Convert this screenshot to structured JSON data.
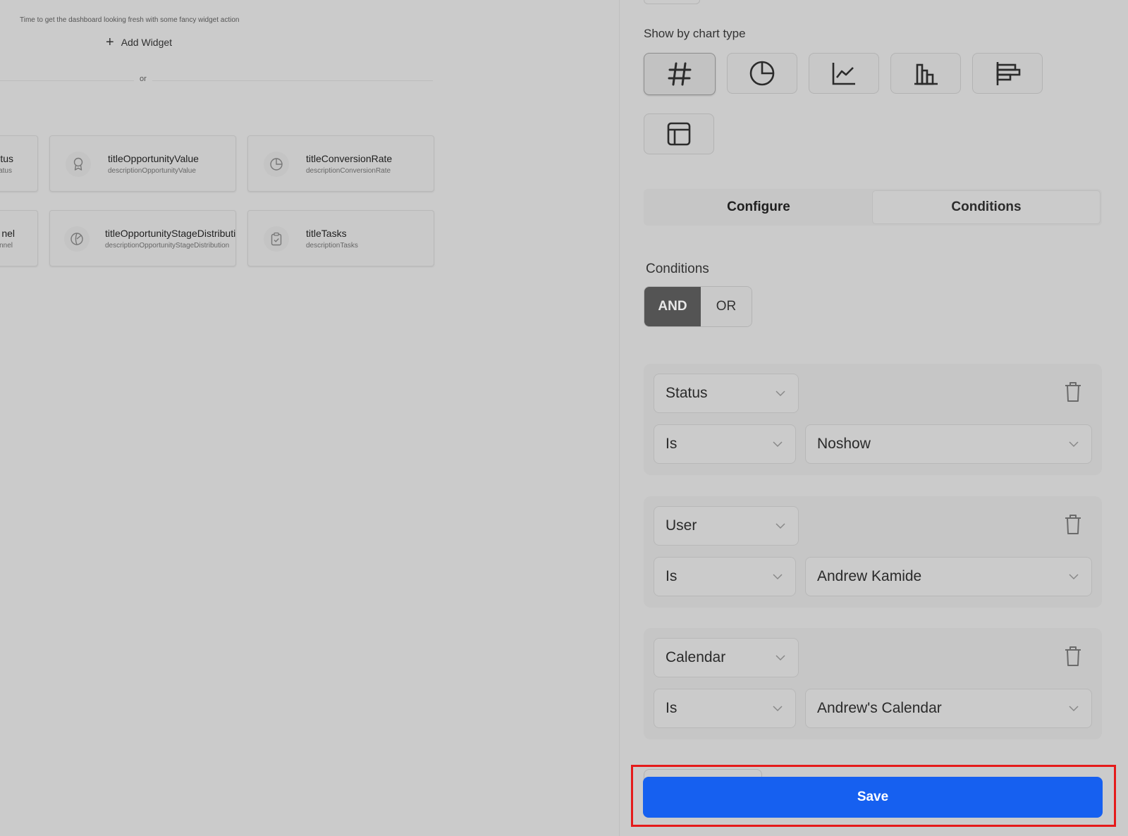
{
  "dashboard": {
    "tagline": "Time to get the dashboard looking fresh with some fancy widget action",
    "add_widget_label": "Add Widget",
    "divider_text": "or",
    "widgets": [
      {
        "title": "tus",
        "description": "atus",
        "icon": "status-icon"
      },
      {
        "title": "titleOpportunityValue",
        "description": "descriptionOpportunityValue",
        "icon": "award-icon"
      },
      {
        "title": "titleConversionRate",
        "description": "descriptionConversionRate",
        "icon": "pie-chart-icon"
      },
      {
        "title": "nel",
        "description": "nnel",
        "icon": "funnel-icon"
      },
      {
        "title": "titleOpportunityStageDistributi",
        "description": "descriptionOpportunityStageDistribution",
        "icon": "stage-distribution-icon"
      },
      {
        "title": "titleTasks",
        "description": "descriptionTasks",
        "icon": "clipboard-check-icon"
      }
    ]
  },
  "panel": {
    "chart_type_label": "Show by chart type",
    "chart_types": [
      {
        "name": "number",
        "icon": "hash-icon",
        "selected": true
      },
      {
        "name": "pie",
        "icon": "pie-chart-icon",
        "selected": false
      },
      {
        "name": "line",
        "icon": "line-chart-icon",
        "selected": false
      },
      {
        "name": "bar",
        "icon": "bar-chart-icon",
        "selected": false
      },
      {
        "name": "horizontal-bar",
        "icon": "horizontal-bar-chart-icon",
        "selected": false
      },
      {
        "name": "table",
        "icon": "table-icon",
        "selected": false
      }
    ],
    "tabs": [
      {
        "label": "Configure",
        "active": false
      },
      {
        "label": "Conditions",
        "active": true
      }
    ],
    "conditions_label": "Conditions",
    "logic": {
      "and_label": "AND",
      "or_label": "OR",
      "selected": "AND"
    },
    "condition_groups": [
      {
        "field": "Status",
        "operator": "Is",
        "value": "Noshow"
      },
      {
        "field": "User",
        "operator": "Is",
        "value": "Andrew Kamide"
      },
      {
        "field": "Calendar",
        "operator": "Is",
        "value": "Andrew's Calendar"
      }
    ],
    "save_label": "Save"
  },
  "colors": {
    "primary": "#1660f0",
    "highlight": "#e51a1a",
    "overlay_gray": "#cbcbcb",
    "logic_selected": "#545454"
  }
}
